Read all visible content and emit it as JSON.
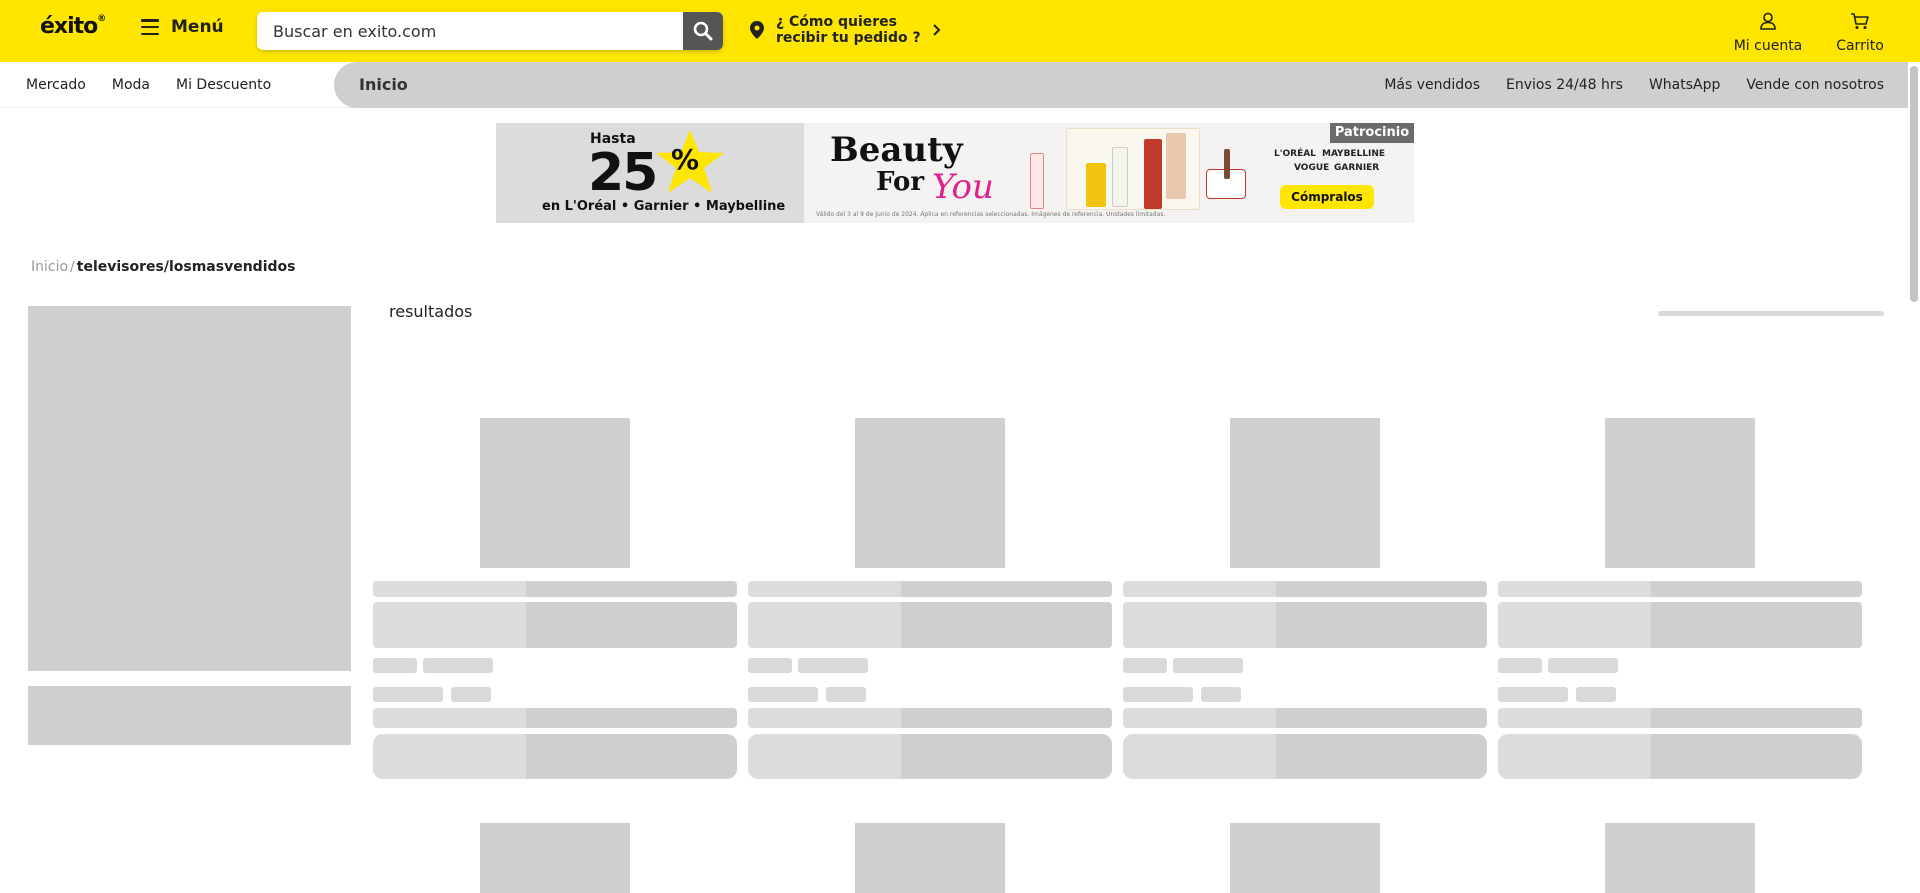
{
  "header": {
    "logo_text": "éxito",
    "menu_label": "Menú",
    "search": {
      "placeholder": "Buscar en exito.com"
    },
    "delivery": {
      "line1": "¿ Cómo quieres",
      "line2": "recibir tu pedido ?"
    },
    "account_label": "Mi cuenta",
    "cart_label": "Carrito",
    "colors": {
      "brand_yellow": "#ffe600",
      "search_button": "#555555"
    }
  },
  "nav": {
    "left_items": [
      "Mercado",
      "Moda",
      "Mi Descuento"
    ],
    "active_tab": "Inicio",
    "right_items": [
      "Más vendidos",
      "Envios 24/48 hrs",
      "WhatsApp",
      "Vende con nosotros"
    ]
  },
  "banner": {
    "hasta": "Hasta",
    "discount": "25",
    "percent": "%",
    "brands_line": "en L'Oréal • Garnier • Maybelline",
    "beauty": "Beauty",
    "for": "For",
    "you": "You",
    "legal": "Válido del 3 al 9 de Junio de 2024. Aplica en referencias seleccionadas. Imágenes de referencia. Unidades limitadas.",
    "sponsored_label": "Patrocinio",
    "brand_logos": [
      "L'ORÉAL",
      "MAYBELLINE",
      "VOGUE",
      "GARNIER"
    ],
    "cta": "Cómpralos"
  },
  "breadcrumb": {
    "home": "Inicio",
    "separator": "/",
    "current": "televisores/losmasvendidos"
  },
  "results": {
    "label": "resultados"
  }
}
